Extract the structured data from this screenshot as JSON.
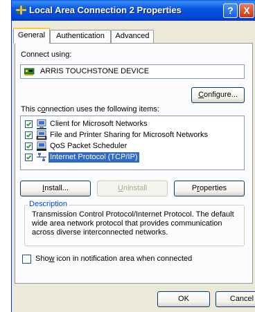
{
  "window": {
    "title": "Local Area Connection 2 Properties",
    "help_label": "?",
    "close_label": "X"
  },
  "tabs": [
    {
      "label": "General",
      "active": true
    },
    {
      "label": "Authentication",
      "active": false
    },
    {
      "label": "Advanced",
      "active": false
    }
  ],
  "general": {
    "connect_using_label": "Connect using:",
    "device_name": "ARRIS TOUCHSTONE DEVICE",
    "configure_button": {
      "pre": "",
      "accel": "C",
      "post": "onfigure..."
    },
    "items_label": {
      "pre": "This c",
      "accel": "o",
      "post": "nnection uses the following items:"
    },
    "items": [
      {
        "label": "Client for Microsoft Networks",
        "checked": true,
        "icon": "client-network-icon"
      },
      {
        "label": "File and Printer Sharing for Microsoft Networks",
        "checked": true,
        "icon": "file-printer-sharing-icon"
      },
      {
        "label": "QoS Packet Scheduler",
        "checked": true,
        "icon": "qos-scheduler-icon"
      },
      {
        "label": "Internet Protocol (TCP/IP)",
        "checked": true,
        "icon": "protocol-icon",
        "selected": true
      }
    ],
    "install_button": {
      "pre": "",
      "accel": "I",
      "post": "nstall..."
    },
    "uninstall_button": {
      "pre": "",
      "accel": "U",
      "post": "ninstall"
    },
    "properties_button": {
      "pre": "P",
      "accel": "r",
      "post": "operties"
    },
    "description": {
      "title": "Description",
      "text": "Transmission Control Protocol/Internet Protocol. The default wide area network protocol that provides communication across diverse interconnected networks."
    },
    "show_icon": {
      "pre": "Sho",
      "accel": "w",
      "post": " icon in notification area when connected",
      "checked": false
    }
  },
  "footer": {
    "ok_label": "OK",
    "cancel_label": "Cancel"
  },
  "colors": {
    "title_bar": "#0245d6",
    "selection": "#316ac5",
    "group_title": "#0046d5"
  }
}
